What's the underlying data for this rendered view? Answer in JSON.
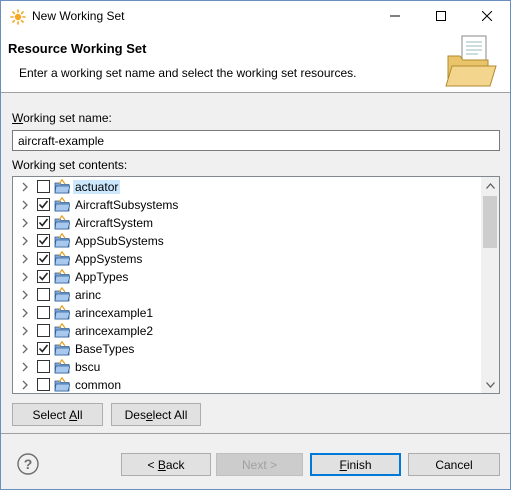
{
  "window": {
    "title": "New Working Set",
    "controls": {
      "minimize": "—",
      "maximize": "☐",
      "close": "✕"
    }
  },
  "header": {
    "title": "Resource Working Set",
    "description": "Enter a working set name and select the working set resources."
  },
  "name_field": {
    "label_mnemonic": "W",
    "label_rest": "orking set name:",
    "value": "aircraft-example"
  },
  "contents": {
    "label": "Working set contents:",
    "items": [
      {
        "label": "actuator",
        "checked": false,
        "selected": true
      },
      {
        "label": "AircraftSubsystems",
        "checked": true,
        "selected": false
      },
      {
        "label": "AircraftSystem",
        "checked": true,
        "selected": false
      },
      {
        "label": "AppSubSystems",
        "checked": true,
        "selected": false
      },
      {
        "label": "AppSystems",
        "checked": true,
        "selected": false
      },
      {
        "label": "AppTypes",
        "checked": true,
        "selected": false
      },
      {
        "label": "arinc",
        "checked": false,
        "selected": false
      },
      {
        "label": "arincexample1",
        "checked": false,
        "selected": false
      },
      {
        "label": "arincexample2",
        "checked": false,
        "selected": false
      },
      {
        "label": "BaseTypes",
        "checked": true,
        "selected": false
      },
      {
        "label": "bscu",
        "checked": false,
        "selected": false
      },
      {
        "label": "common",
        "checked": false,
        "selected": false
      }
    ]
  },
  "buttons": {
    "select_all_pre": "Select ",
    "select_all_mn": "A",
    "select_all_post": "ll",
    "deselect_all_pre": "Des",
    "deselect_all_mn": "e",
    "deselect_all_post": "lect All",
    "back_pre": "< ",
    "back_mn": "B",
    "back_post": "ack",
    "next": "Next >",
    "finish_mn": "F",
    "finish_post": "inish",
    "cancel": "Cancel"
  },
  "colors": {
    "selection": "#cce8ff",
    "default_button_border": "#0078d7",
    "disabled_text": "#a0a0a0"
  }
}
